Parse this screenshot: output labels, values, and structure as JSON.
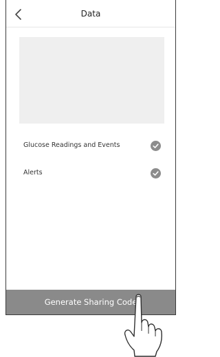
{
  "header": {
    "title": "Data",
    "back_icon": "chevron-left-icon"
  },
  "options": [
    {
      "label": "Glucose Readings and Events",
      "checked": true,
      "icon": "checkmark-circle-icon"
    },
    {
      "label": "Alerts",
      "checked": true,
      "icon": "checkmark-circle-icon"
    }
  ],
  "footer": {
    "action_label": "Generate Sharing Code"
  },
  "colors": {
    "bar": "#8a8a8a",
    "check": "#8c8c8c",
    "placeholder": "#efefef"
  },
  "overlay": {
    "icon": "tapping-hand-icon"
  }
}
